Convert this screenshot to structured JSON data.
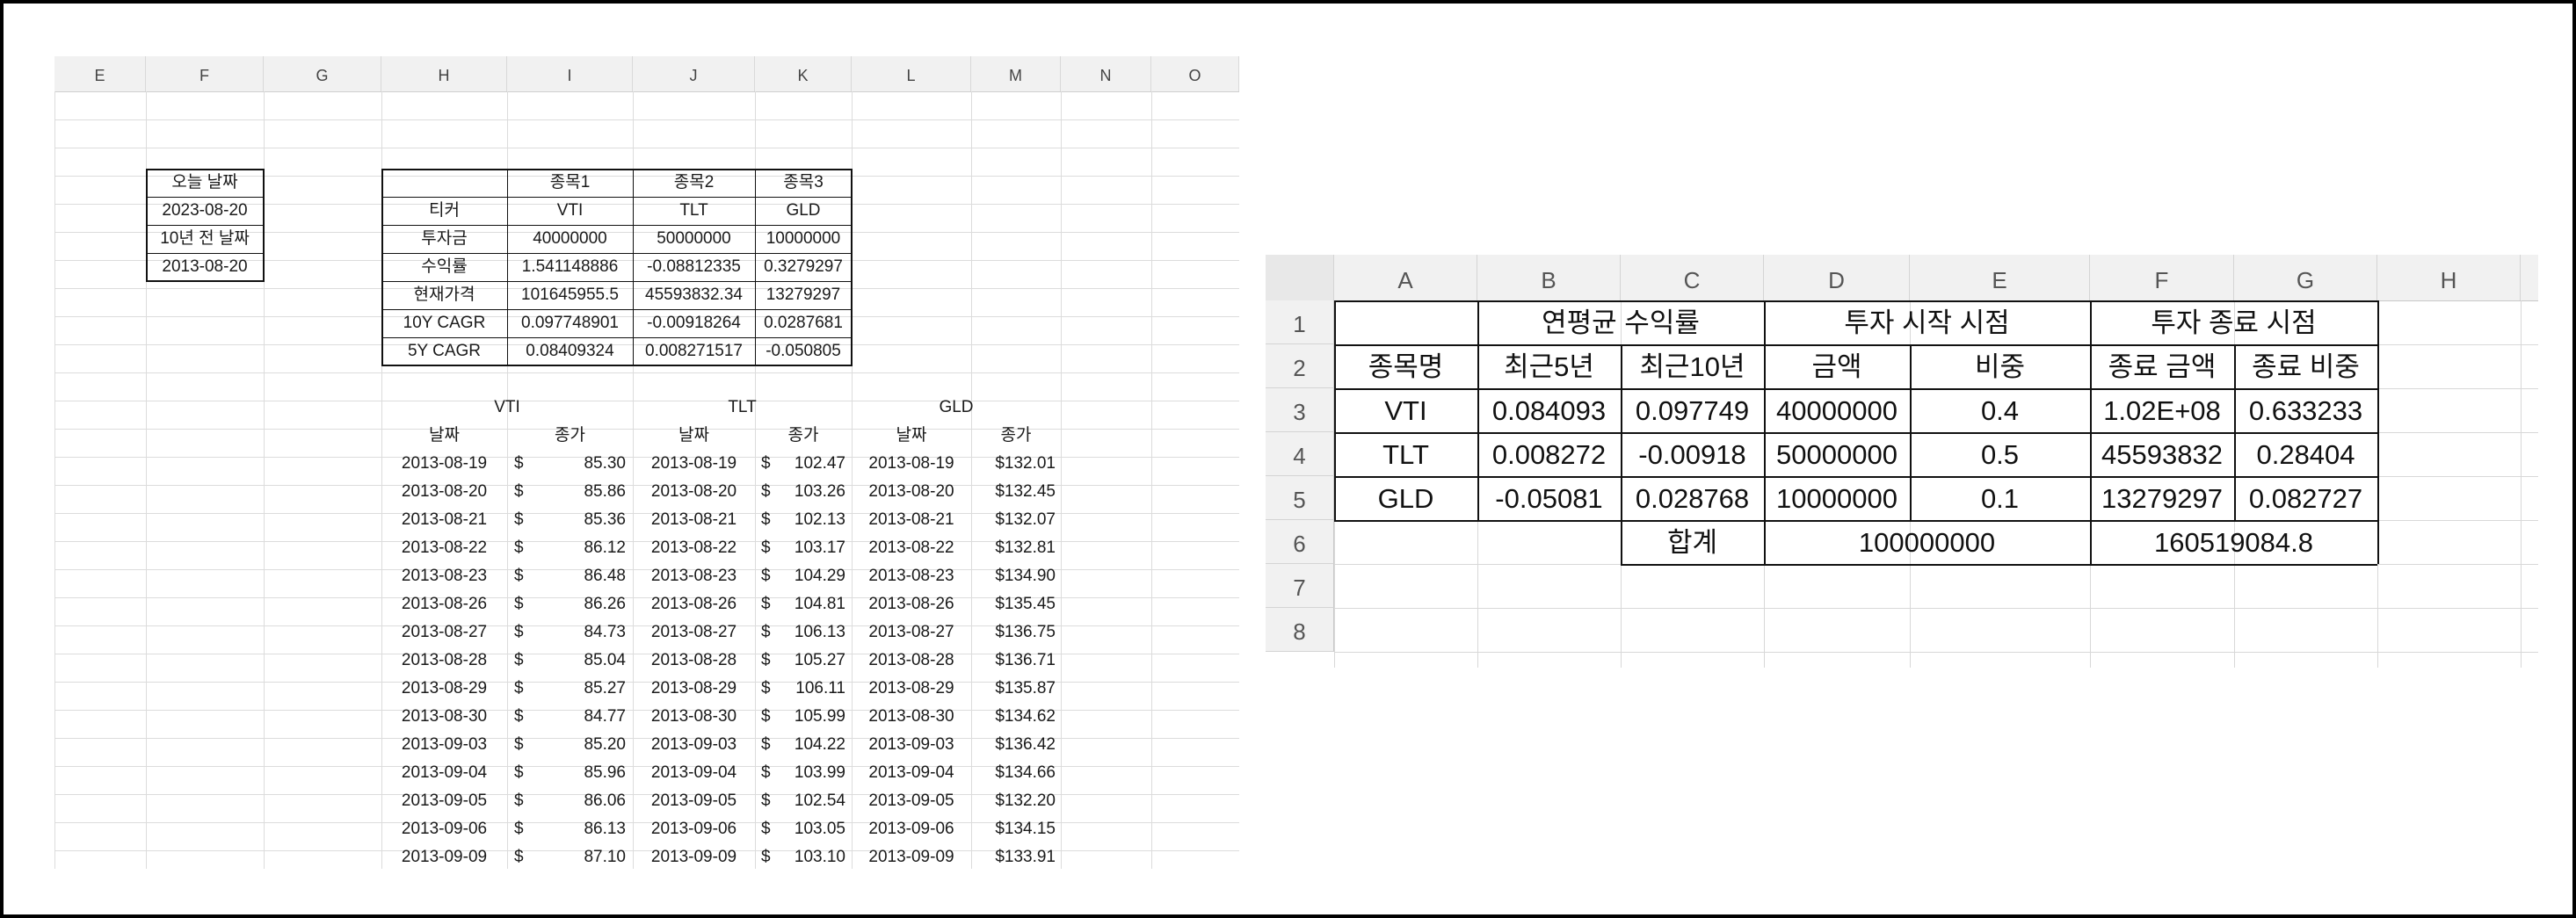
{
  "left_sheet": {
    "columns": [
      "E",
      "F",
      "G",
      "H",
      "I",
      "J",
      "K",
      "L",
      "M",
      "N",
      "O"
    ],
    "date_box": [
      "오늘 날짜",
      "2023-08-20",
      "10년 전 날짜",
      "2013-08-20"
    ],
    "summary_headers": [
      "",
      "종목1",
      "종목2",
      "종목3"
    ],
    "summary_rows": [
      [
        "티커",
        "VTI",
        "TLT",
        "GLD"
      ],
      [
        "투자금",
        "40000000",
        "50000000",
        "10000000"
      ],
      [
        "수익률",
        "1.541148886",
        "-0.08812335",
        "0.3279297"
      ],
      [
        "현재가격",
        "101645955.5",
        "45593832.34",
        "13279297"
      ],
      [
        "10Y CAGR",
        "0.097748901",
        "-0.00918264",
        "0.0287681"
      ],
      [
        "5Y CAGR",
        "0.08409324",
        "0.008271517",
        "-0.050805"
      ]
    ],
    "price_groups": [
      "VTI",
      "TLT",
      "GLD"
    ],
    "price_subheaders": [
      "날짜",
      "종가",
      "날짜",
      "종가",
      "날짜",
      "종가"
    ],
    "price_rows": [
      [
        "2013-08-19",
        "$",
        "85.30",
        "2013-08-19",
        "$",
        "102.47",
        "2013-08-19",
        "$132.01"
      ],
      [
        "2013-08-20",
        "$",
        "85.86",
        "2013-08-20",
        "$",
        "103.26",
        "2013-08-20",
        "$132.45"
      ],
      [
        "2013-08-21",
        "$",
        "85.36",
        "2013-08-21",
        "$",
        "102.13",
        "2013-08-21",
        "$132.07"
      ],
      [
        "2013-08-22",
        "$",
        "86.12",
        "2013-08-22",
        "$",
        "103.17",
        "2013-08-22",
        "$132.81"
      ],
      [
        "2013-08-23",
        "$",
        "86.48",
        "2013-08-23",
        "$",
        "104.29",
        "2013-08-23",
        "$134.90"
      ],
      [
        "2013-08-26",
        "$",
        "86.26",
        "2013-08-26",
        "$",
        "104.81",
        "2013-08-26",
        "$135.45"
      ],
      [
        "2013-08-27",
        "$",
        "84.73",
        "2013-08-27",
        "$",
        "106.13",
        "2013-08-27",
        "$136.75"
      ],
      [
        "2013-08-28",
        "$",
        "85.04",
        "2013-08-28",
        "$",
        "105.27",
        "2013-08-28",
        "$136.71"
      ],
      [
        "2013-08-29",
        "$",
        "85.27",
        "2013-08-29",
        "$",
        "106.11",
        "2013-08-29",
        "$135.87"
      ],
      [
        "2013-08-30",
        "$",
        "84.77",
        "2013-08-30",
        "$",
        "105.99",
        "2013-08-30",
        "$134.62"
      ],
      [
        "2013-09-03",
        "$",
        "85.20",
        "2013-09-03",
        "$",
        "104.22",
        "2013-09-03",
        "$136.42"
      ],
      [
        "2013-09-04",
        "$",
        "85.96",
        "2013-09-04",
        "$",
        "103.99",
        "2013-09-04",
        "$134.66"
      ],
      [
        "2013-09-05",
        "$",
        "86.06",
        "2013-09-05",
        "$",
        "102.54",
        "2013-09-05",
        "$132.20"
      ],
      [
        "2013-09-06",
        "$",
        "86.13",
        "2013-09-06",
        "$",
        "103.05",
        "2013-09-06",
        "$134.15"
      ],
      [
        "2013-09-09",
        "$",
        "87.10",
        "2013-09-09",
        "$",
        "103.10",
        "2013-09-09",
        "$133.91"
      ]
    ]
  },
  "right_sheet": {
    "columns": [
      "A",
      "B",
      "C",
      "D",
      "E",
      "F",
      "G",
      "H"
    ],
    "row_numbers": [
      "1",
      "2",
      "3",
      "4",
      "5",
      "6",
      "7",
      "8"
    ],
    "row1": {
      "cagr": "연평균 수익률",
      "start": "투자 시작 시점",
      "end": "투자 종료 시점"
    },
    "row2": [
      "종목명",
      "최근5년",
      "최근10년",
      "금액",
      "비중",
      "종료 금액",
      "종료 비중"
    ],
    "data_rows": [
      [
        "VTI",
        "0.084093",
        "0.097749",
        "40000000",
        "0.4",
        "1.02E+08",
        "0.633233"
      ],
      [
        "TLT",
        "0.008272",
        "-0.00918",
        "50000000",
        "0.5",
        "45593832",
        "0.28404"
      ],
      [
        "GLD",
        "-0.05081",
        "0.028768",
        "10000000",
        "0.1",
        "13279297",
        "0.082727"
      ]
    ],
    "total": {
      "label": "합계",
      "start_total": "100000000",
      "end_total": "160519084.8"
    }
  }
}
